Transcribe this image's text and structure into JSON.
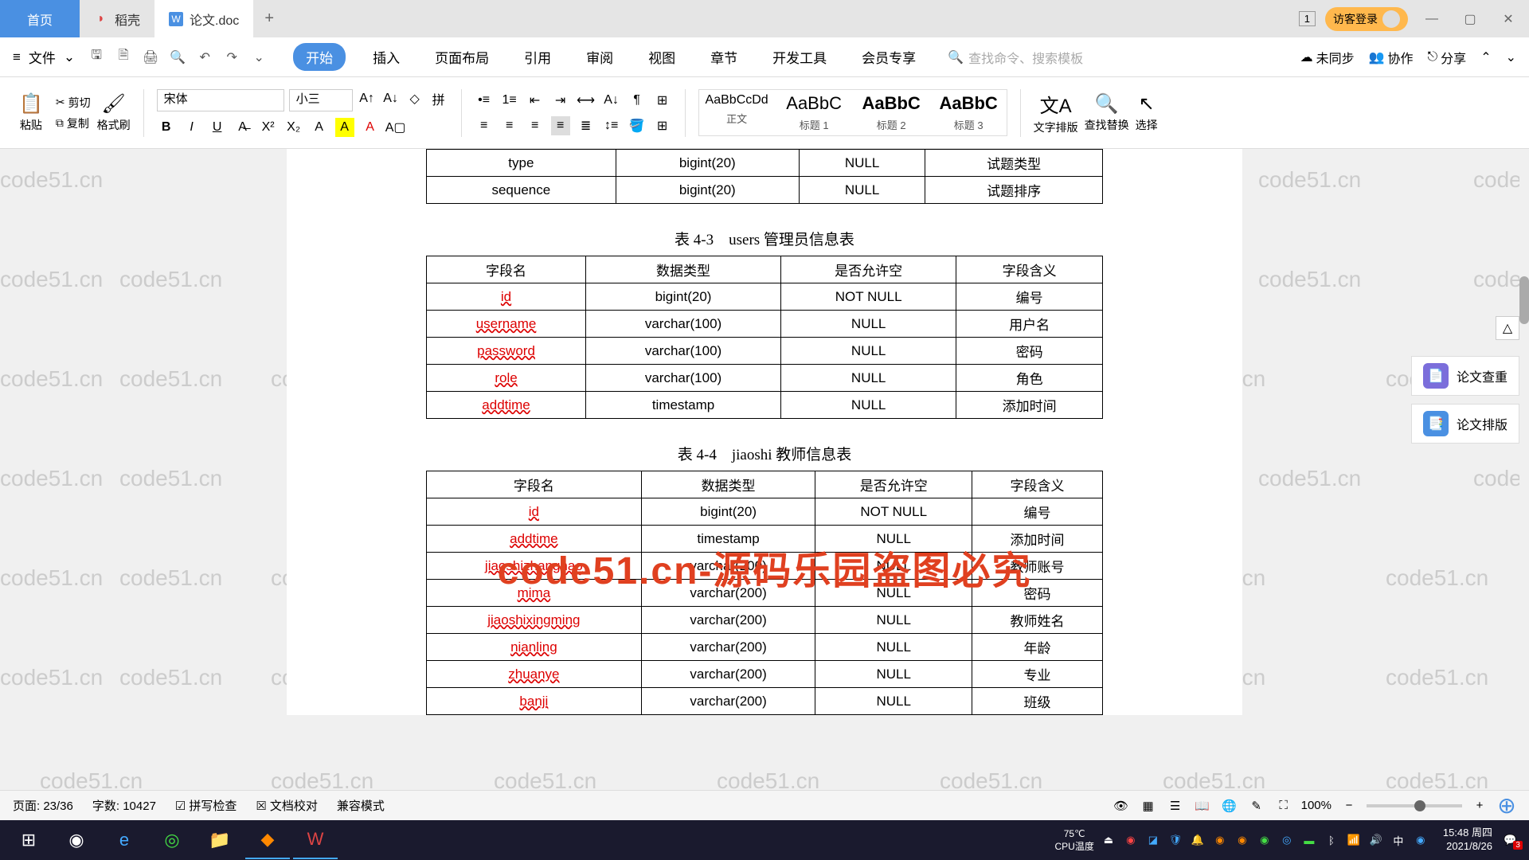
{
  "tabs": {
    "home": "首页",
    "daoke": "稻壳",
    "active": "论文.doc",
    "counter": "1",
    "guest_login": "访客登录"
  },
  "menubar": {
    "file": "文件",
    "items": [
      "开始",
      "插入",
      "页面布局",
      "引用",
      "审阅",
      "视图",
      "章节",
      "开发工具",
      "会员专享"
    ],
    "search_placeholder": "查找命令、搜索模板",
    "right": {
      "sync": "未同步",
      "collab": "协作",
      "share": "分享"
    }
  },
  "ribbon": {
    "paste": "粘贴",
    "cut": "剪切",
    "copy": "复制",
    "format_painter": "格式刷",
    "font_name": "宋体",
    "font_size": "小三",
    "styles": [
      {
        "preview": "AaBbCcDd",
        "name": "正文"
      },
      {
        "preview": "AaBbC",
        "name": "标题 1"
      },
      {
        "preview": "AaBbC",
        "name": "标题 2"
      },
      {
        "preview": "AaBbC",
        "name": "标题 3"
      }
    ],
    "text_layout": "文字排版",
    "find_replace": "查找替换",
    "select": "选择"
  },
  "document": {
    "table0_rows": [
      [
        "type",
        "bigint(20)",
        "NULL",
        "试题类型"
      ],
      [
        "sequence",
        "bigint(20)",
        "NULL",
        "试题排序"
      ]
    ],
    "table1_caption": "表 4-3　users 管理员信息表",
    "table1_header": [
      "字段名",
      "数据类型",
      "是否允许空",
      "字段含义"
    ],
    "table1_rows": [
      [
        "id",
        "bigint(20)",
        "NOT NULL",
        "编号"
      ],
      [
        "username",
        "varchar(100)",
        "NULL",
        "用户名"
      ],
      [
        "password",
        "varchar(100)",
        "NULL",
        "密码"
      ],
      [
        "role",
        "varchar(100)",
        "NULL",
        "角色"
      ],
      [
        "addtime",
        "timestamp",
        "NULL",
        "添加时间"
      ]
    ],
    "table2_caption": "表 4-4　jiaoshi 教师信息表",
    "table2_header": [
      "字段名",
      "数据类型",
      "是否允许空",
      "字段含义"
    ],
    "table2_rows": [
      [
        "id",
        "bigint(20)",
        "NOT NULL",
        "编号"
      ],
      [
        "addtime",
        "timestamp",
        "NULL",
        "添加时间"
      ],
      [
        "jiaoshizhanghao",
        "varchar(200)",
        "NULL",
        "教师账号"
      ],
      [
        "mima",
        "varchar(200)",
        "NULL",
        "密码"
      ],
      [
        "jiaoshixingming",
        "varchar(200)",
        "NULL",
        "教师姓名"
      ],
      [
        "nianling",
        "varchar(200)",
        "NULL",
        "年龄"
      ],
      [
        "zhuanye",
        "varchar(200)",
        "NULL",
        "专业"
      ],
      [
        "banji",
        "varchar(200)",
        "NULL",
        "班级"
      ]
    ],
    "big_watermark": "code51.cn-源码乐园盗图必究"
  },
  "right_panel": {
    "check_dup": "论文查重",
    "layout": "论文排版"
  },
  "statusbar": {
    "page": "页面: 23/36",
    "words": "字数: 10427",
    "spellcheck": "拼写检查",
    "doccheck": "文档校对",
    "compat": "兼容模式",
    "zoom": "100%"
  },
  "taskbar": {
    "cpu_label": "CPU温度",
    "cpu_temp": "75℃",
    "time": "15:48 周四",
    "date": "2021/8/26",
    "notif_count": "3"
  },
  "watermark_text": "code51.cn"
}
